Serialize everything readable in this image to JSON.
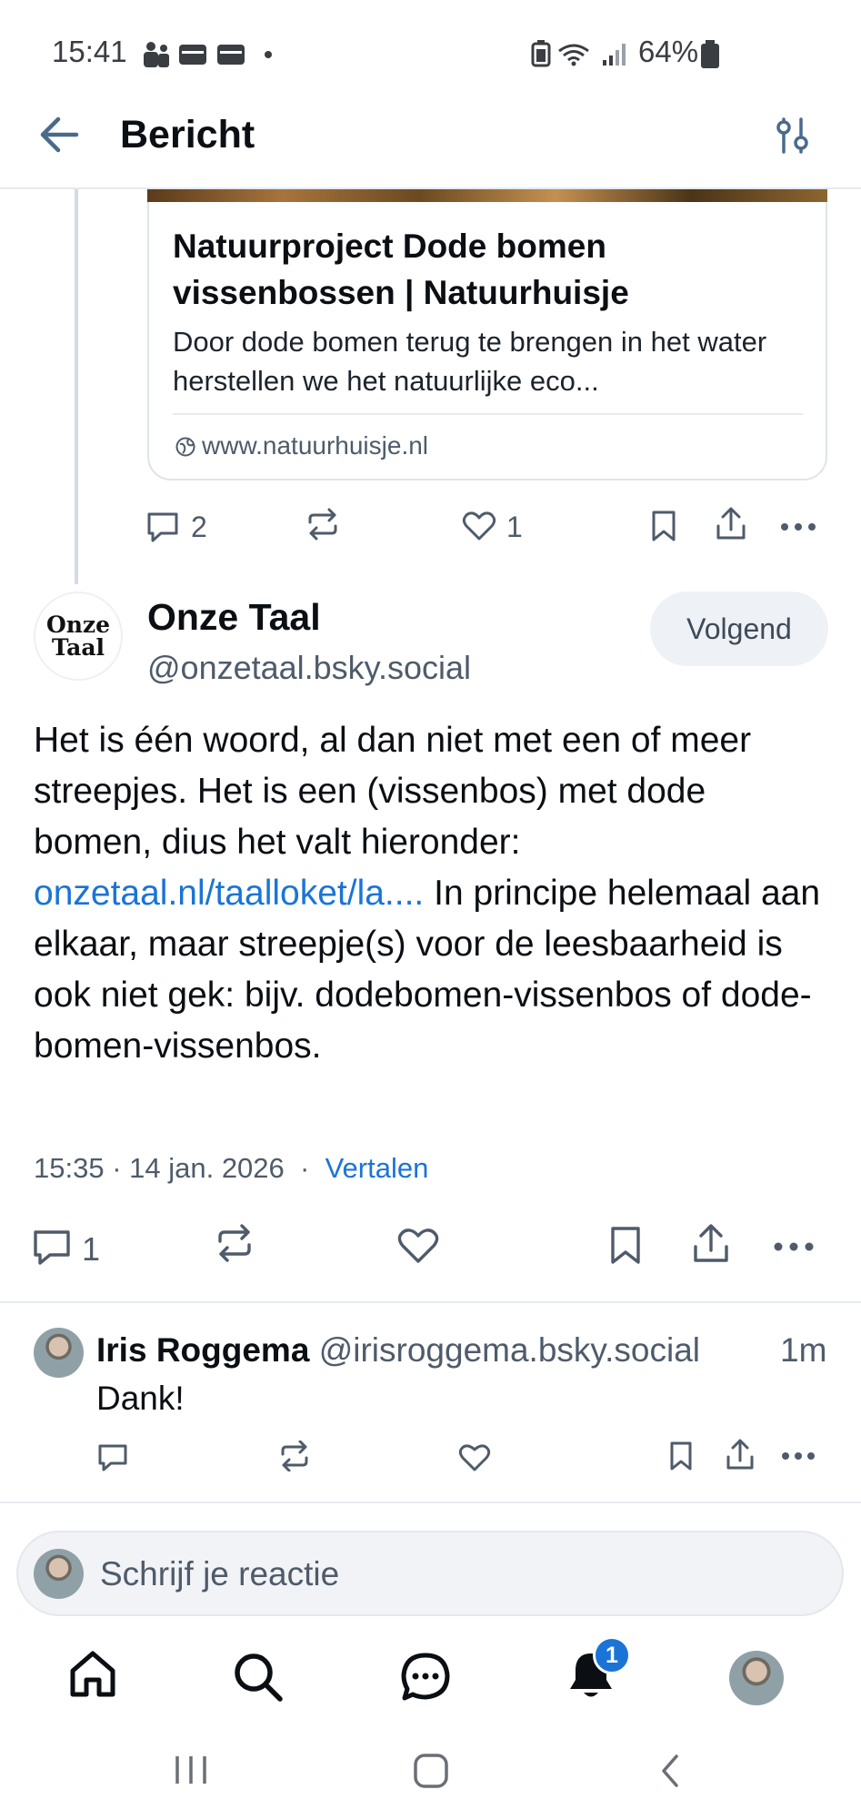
{
  "status_bar": {
    "time": "15:41",
    "battery": "64%"
  },
  "header": {
    "title": "Bericht"
  },
  "link_card": {
    "title": "Natuurproject Dode bomen vissenbossen | Natuurhuisje",
    "description": "Door dode bomen terug te brengen in het water herstellen we het natuurlijke eco...",
    "domain": "www.natuurhuisje.nl"
  },
  "parent_actions": {
    "replies": "2",
    "likes": "1"
  },
  "post": {
    "author_name": "Onze Taal",
    "author_handle": "@onzetaal.bsky.social",
    "avatar_text_line1": "Onze",
    "avatar_text_line2": "Taal",
    "follow_label": "Volgend",
    "text_before_link": "Het is één woord, al dan niet met een of meer streepjes. Het is een (vissenbos) met dode bomen, dius het valt hieronder: ",
    "link_text": "onzetaal.nl/taalloket/la....",
    "text_after_link": " In principe helemaal aan elkaar, maar streepje(s) voor de leesbaarheid is ook niet gek: bijv. dodebomen-vissenbos of dode-bomen-vissenbos.",
    "timestamp": "15:35 · 14 jan. 2026",
    "separator": "·",
    "translate_label": "Vertalen",
    "reply_count": "1"
  },
  "reply": {
    "author_name": "Iris Roggema",
    "author_handle": "@irisroggema.bsky.social",
    "time": "1m",
    "text": "Dank!"
  },
  "composer": {
    "placeholder": "Schrijf je reactie"
  },
  "bottom_nav": {
    "notification_badge": "1"
  },
  "colors": {
    "accent": "#1a74d6",
    "icon": "#4f5b6a"
  }
}
